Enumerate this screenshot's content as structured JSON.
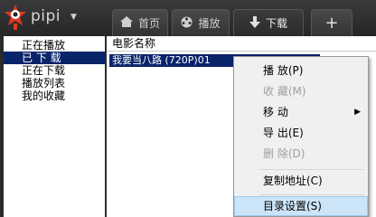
{
  "header": {
    "brand": "pipi",
    "brand_dropdown_icon": "chevron-down-icon",
    "tabs": [
      {
        "label": "首页",
        "icon": "home-icon"
      },
      {
        "label": "播放",
        "icon": "film-reel-icon"
      },
      {
        "label": "下载",
        "icon": "download-arrow-icon"
      },
      {
        "label": "+",
        "icon": "plus-icon"
      }
    ]
  },
  "sidebar": {
    "items": [
      {
        "label": "正在播放"
      },
      {
        "label": "已 下 载"
      },
      {
        "label": "正在下载"
      },
      {
        "label": "播放列表"
      },
      {
        "label": "我的收藏"
      }
    ],
    "selected_index": 1
  },
  "main": {
    "column_header": "电影名称",
    "rows": [
      {
        "name": "我要当八路 (720P)01"
      }
    ]
  },
  "context_menu": {
    "items": [
      {
        "label": "播    放(P)",
        "enabled": true
      },
      {
        "label": "收    藏(M)",
        "enabled": false
      },
      {
        "label": "移    动",
        "enabled": true,
        "has_submenu": true
      },
      {
        "label": "导    出(E)",
        "enabled": true
      },
      {
        "label": "删    除(D)",
        "enabled": false
      },
      {
        "label": "复制地址(C)",
        "enabled": true
      },
      {
        "label": "目录设置(S)",
        "enabled": true,
        "hovered": true
      }
    ]
  },
  "colors": {
    "selection": "#0a246a",
    "header_bg": "#2b2b2b",
    "menu_bg": "#f0f0f0",
    "menu_hover": "#cce4f7",
    "logo_red": "#e03a1e"
  }
}
